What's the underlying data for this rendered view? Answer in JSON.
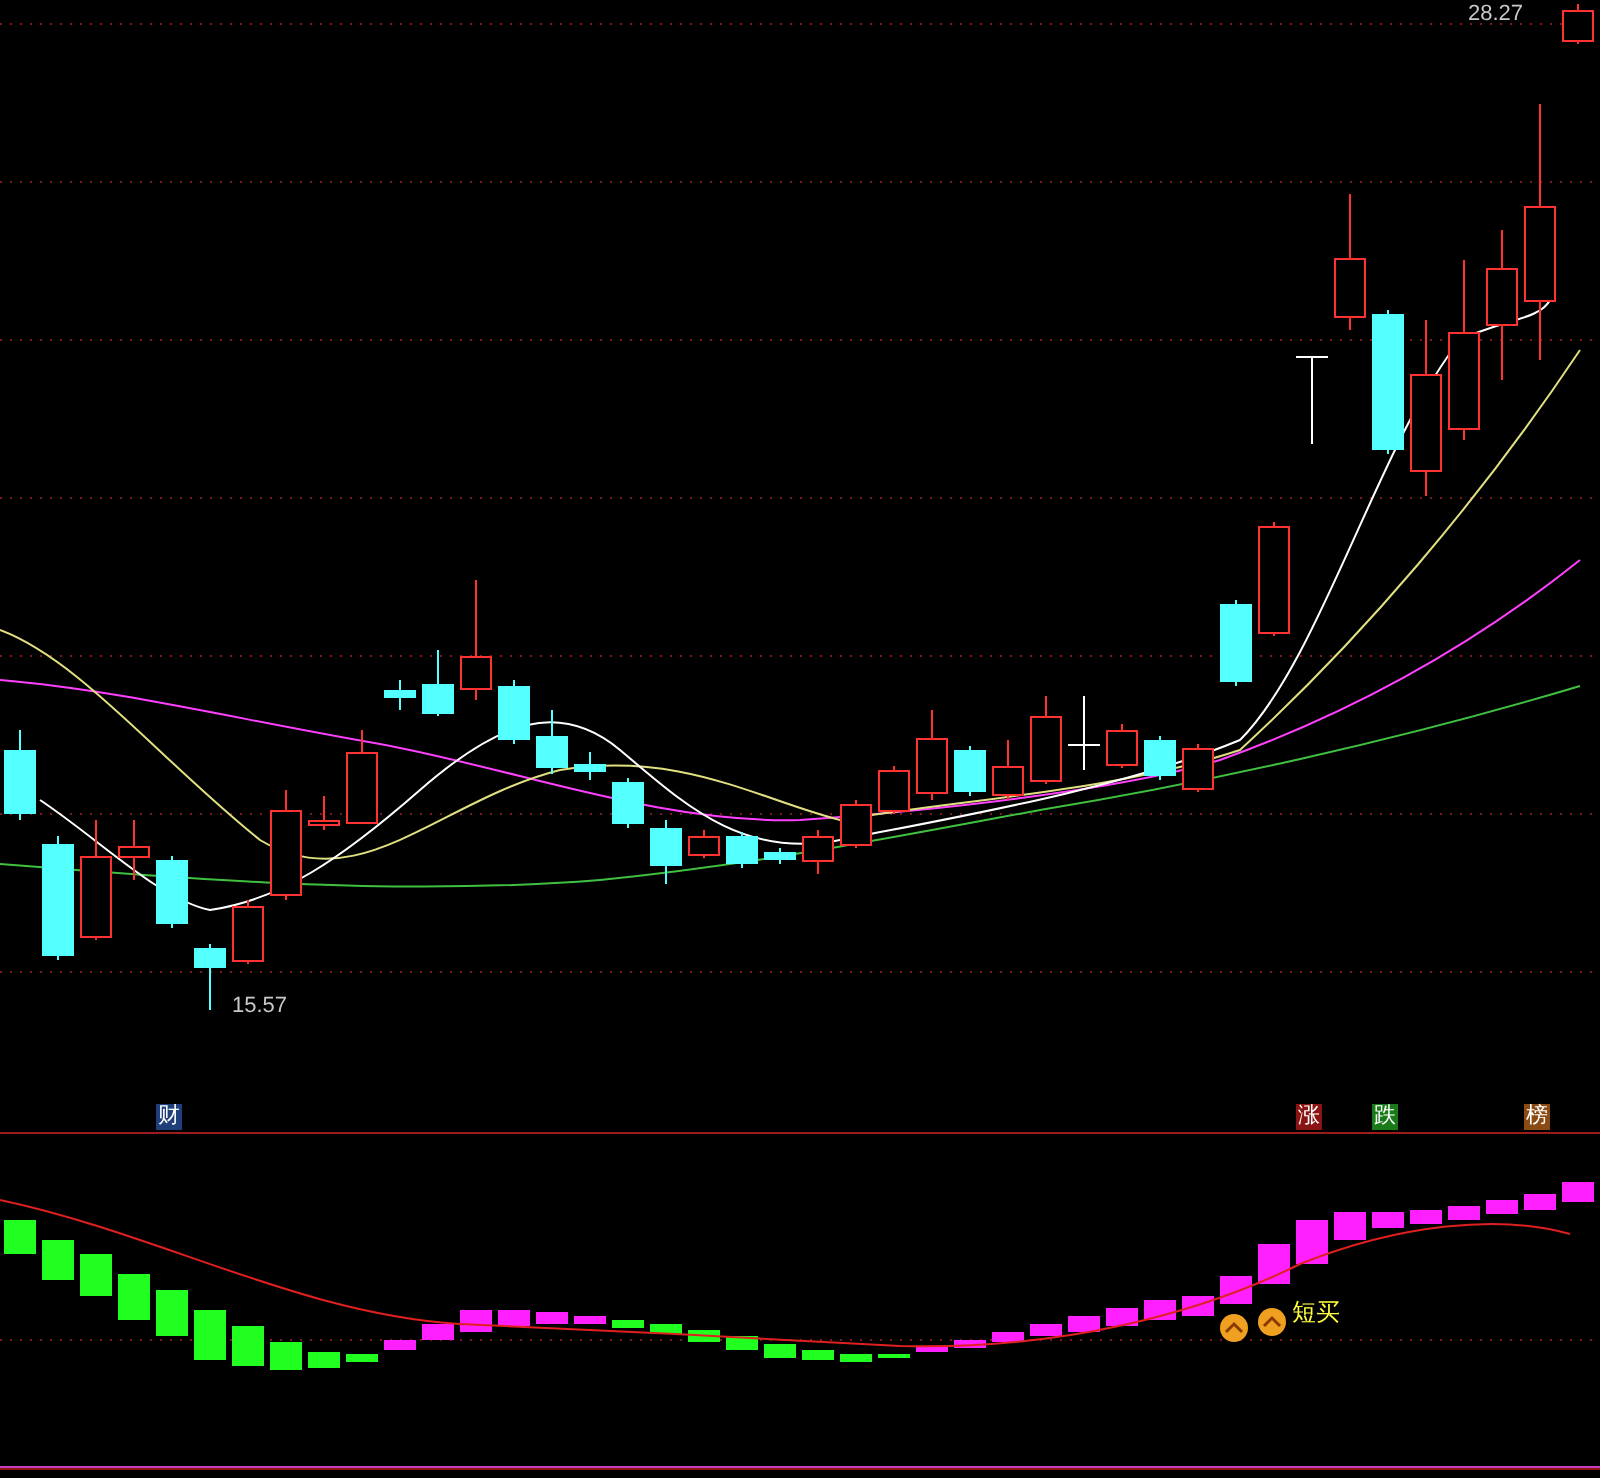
{
  "price_chart": {
    "high_label": "28.27",
    "low_label": "15.57"
  },
  "tags": [
    {
      "label": "财",
      "color": "#1e3f7a"
    },
    {
      "label": "涨",
      "color": "#8a1414"
    },
    {
      "label": "跌",
      "color": "#1a7a1a"
    },
    {
      "label": "榜",
      "color": "#8a4a14"
    }
  ],
  "indicator": {
    "signal_label": "短买"
  }
}
